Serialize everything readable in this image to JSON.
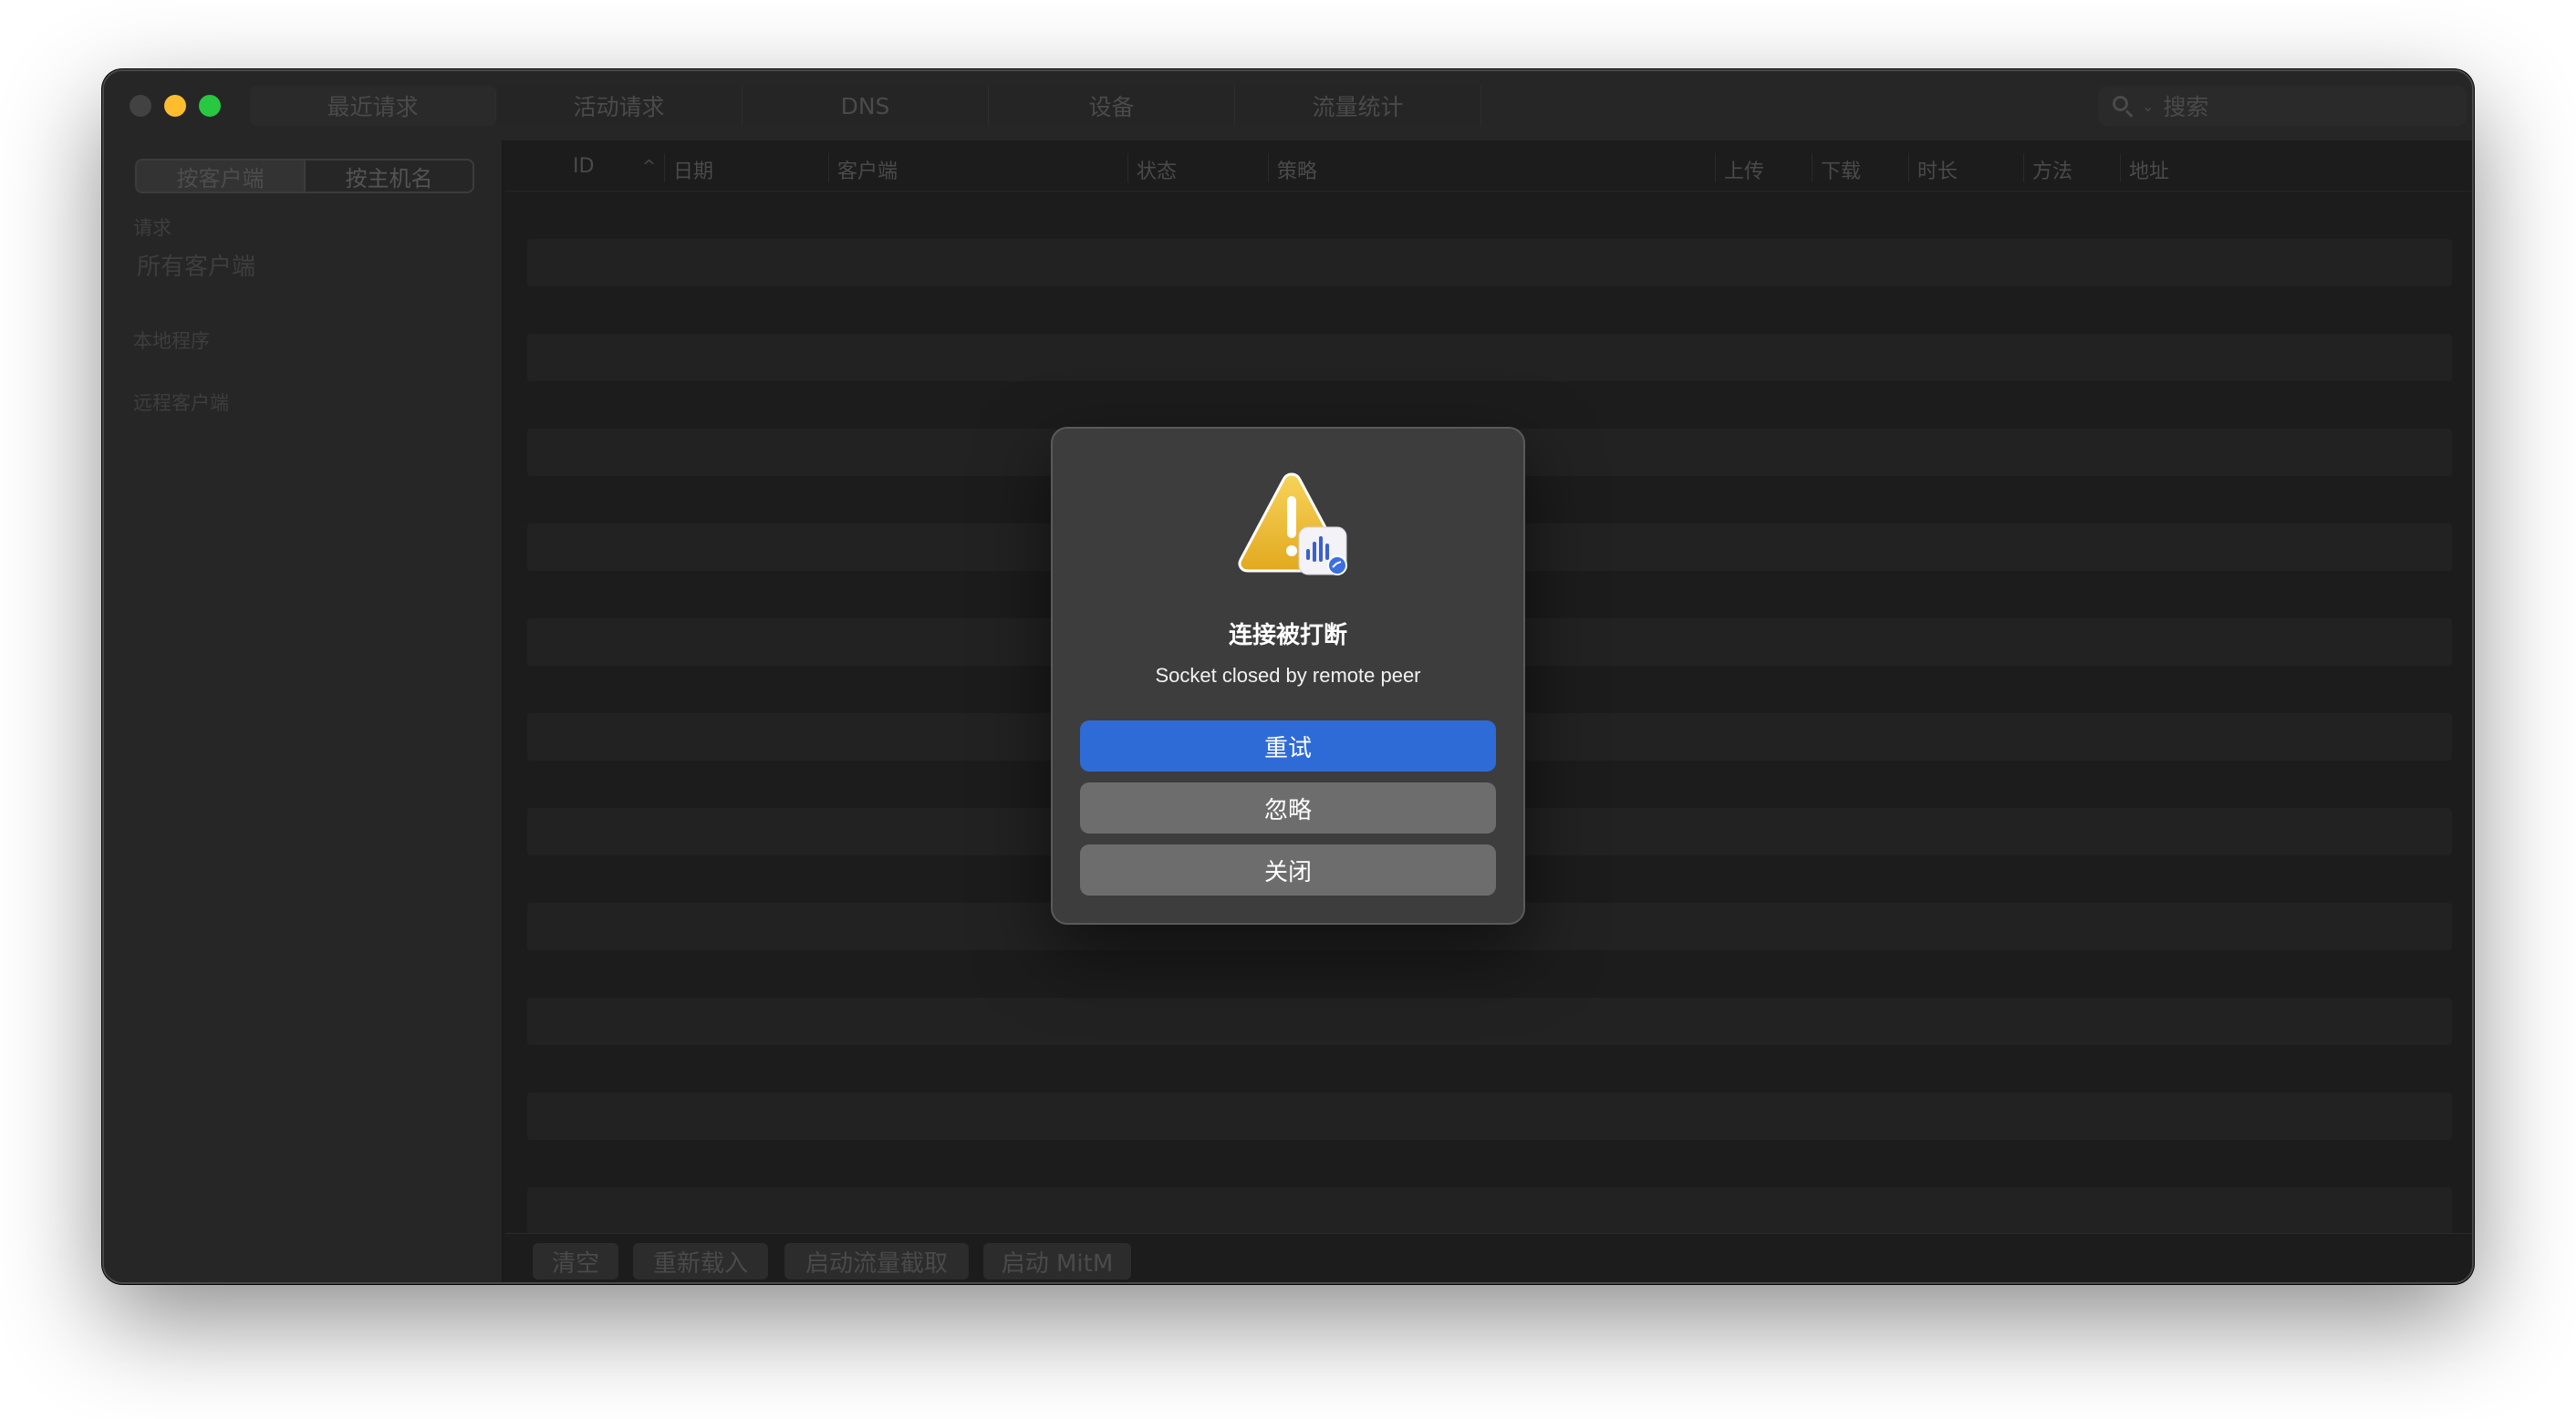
{
  "toolbar": {
    "tabs": [
      "最近请求",
      "活动请求",
      "DNS",
      "设备",
      "流量统计"
    ],
    "search_placeholder": "搜索"
  },
  "sidebar": {
    "segments": [
      "按客户端",
      "按主机名"
    ],
    "section_requests": "请求",
    "all_clients": "所有客户端",
    "section_local": "本地程序",
    "section_remote": "远程客户端"
  },
  "table": {
    "columns": [
      "ID",
      "日期",
      "客户端",
      "状态",
      "策略",
      "上传",
      "下载",
      "时长",
      "方法",
      "地址"
    ],
    "sort_indicator": "^"
  },
  "bottom_toolbar": {
    "clear": "清空",
    "reload": "重新载入",
    "start_capture": "启动流量截取",
    "start_mitm": "启动 MitM"
  },
  "dialog": {
    "title": "连接被打断",
    "message": "Socket closed by remote peer",
    "retry": "重试",
    "ignore": "忽略",
    "close": "关闭",
    "icon": "warning-icon"
  },
  "colors": {
    "primary_button": "#2f6bd6",
    "warning_yellow": "#f2c233",
    "traffic_close": "#424242",
    "traffic_minimize": "#febc2e",
    "traffic_maximize": "#28c840"
  }
}
